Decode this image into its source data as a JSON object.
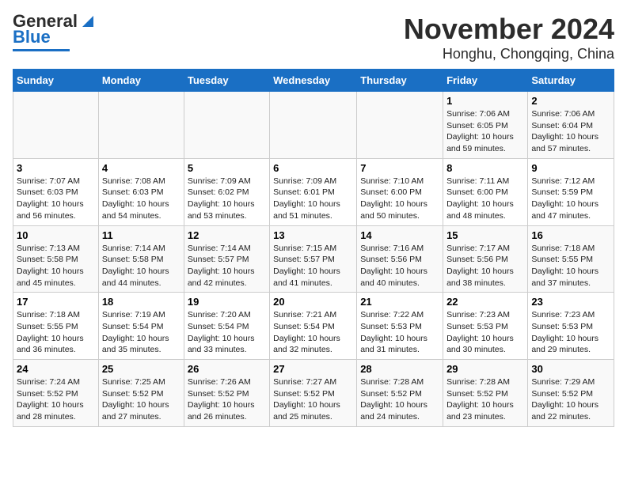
{
  "header": {
    "logo_line1": "General",
    "logo_line2": "Blue",
    "month": "November 2024",
    "location": "Honghu, Chongqing, China"
  },
  "columns": [
    "Sunday",
    "Monday",
    "Tuesday",
    "Wednesday",
    "Thursday",
    "Friday",
    "Saturday"
  ],
  "weeks": [
    [
      {
        "day": "",
        "info": ""
      },
      {
        "day": "",
        "info": ""
      },
      {
        "day": "",
        "info": ""
      },
      {
        "day": "",
        "info": ""
      },
      {
        "day": "",
        "info": ""
      },
      {
        "day": "1",
        "info": "Sunrise: 7:06 AM\nSunset: 6:05 PM\nDaylight: 10 hours and 59 minutes."
      },
      {
        "day": "2",
        "info": "Sunrise: 7:06 AM\nSunset: 6:04 PM\nDaylight: 10 hours and 57 minutes."
      }
    ],
    [
      {
        "day": "3",
        "info": "Sunrise: 7:07 AM\nSunset: 6:03 PM\nDaylight: 10 hours and 56 minutes."
      },
      {
        "day": "4",
        "info": "Sunrise: 7:08 AM\nSunset: 6:03 PM\nDaylight: 10 hours and 54 minutes."
      },
      {
        "day": "5",
        "info": "Sunrise: 7:09 AM\nSunset: 6:02 PM\nDaylight: 10 hours and 53 minutes."
      },
      {
        "day": "6",
        "info": "Sunrise: 7:09 AM\nSunset: 6:01 PM\nDaylight: 10 hours and 51 minutes."
      },
      {
        "day": "7",
        "info": "Sunrise: 7:10 AM\nSunset: 6:00 PM\nDaylight: 10 hours and 50 minutes."
      },
      {
        "day": "8",
        "info": "Sunrise: 7:11 AM\nSunset: 6:00 PM\nDaylight: 10 hours and 48 minutes."
      },
      {
        "day": "9",
        "info": "Sunrise: 7:12 AM\nSunset: 5:59 PM\nDaylight: 10 hours and 47 minutes."
      }
    ],
    [
      {
        "day": "10",
        "info": "Sunrise: 7:13 AM\nSunset: 5:58 PM\nDaylight: 10 hours and 45 minutes."
      },
      {
        "day": "11",
        "info": "Sunrise: 7:14 AM\nSunset: 5:58 PM\nDaylight: 10 hours and 44 minutes."
      },
      {
        "day": "12",
        "info": "Sunrise: 7:14 AM\nSunset: 5:57 PM\nDaylight: 10 hours and 42 minutes."
      },
      {
        "day": "13",
        "info": "Sunrise: 7:15 AM\nSunset: 5:57 PM\nDaylight: 10 hours and 41 minutes."
      },
      {
        "day": "14",
        "info": "Sunrise: 7:16 AM\nSunset: 5:56 PM\nDaylight: 10 hours and 40 minutes."
      },
      {
        "day": "15",
        "info": "Sunrise: 7:17 AM\nSunset: 5:56 PM\nDaylight: 10 hours and 38 minutes."
      },
      {
        "day": "16",
        "info": "Sunrise: 7:18 AM\nSunset: 5:55 PM\nDaylight: 10 hours and 37 minutes."
      }
    ],
    [
      {
        "day": "17",
        "info": "Sunrise: 7:18 AM\nSunset: 5:55 PM\nDaylight: 10 hours and 36 minutes."
      },
      {
        "day": "18",
        "info": "Sunrise: 7:19 AM\nSunset: 5:54 PM\nDaylight: 10 hours and 35 minutes."
      },
      {
        "day": "19",
        "info": "Sunrise: 7:20 AM\nSunset: 5:54 PM\nDaylight: 10 hours and 33 minutes."
      },
      {
        "day": "20",
        "info": "Sunrise: 7:21 AM\nSunset: 5:54 PM\nDaylight: 10 hours and 32 minutes."
      },
      {
        "day": "21",
        "info": "Sunrise: 7:22 AM\nSunset: 5:53 PM\nDaylight: 10 hours and 31 minutes."
      },
      {
        "day": "22",
        "info": "Sunrise: 7:23 AM\nSunset: 5:53 PM\nDaylight: 10 hours and 30 minutes."
      },
      {
        "day": "23",
        "info": "Sunrise: 7:23 AM\nSunset: 5:53 PM\nDaylight: 10 hours and 29 minutes."
      }
    ],
    [
      {
        "day": "24",
        "info": "Sunrise: 7:24 AM\nSunset: 5:52 PM\nDaylight: 10 hours and 28 minutes."
      },
      {
        "day": "25",
        "info": "Sunrise: 7:25 AM\nSunset: 5:52 PM\nDaylight: 10 hours and 27 minutes."
      },
      {
        "day": "26",
        "info": "Sunrise: 7:26 AM\nSunset: 5:52 PM\nDaylight: 10 hours and 26 minutes."
      },
      {
        "day": "27",
        "info": "Sunrise: 7:27 AM\nSunset: 5:52 PM\nDaylight: 10 hours and 25 minutes."
      },
      {
        "day": "28",
        "info": "Sunrise: 7:28 AM\nSunset: 5:52 PM\nDaylight: 10 hours and 24 minutes."
      },
      {
        "day": "29",
        "info": "Sunrise: 7:28 AM\nSunset: 5:52 PM\nDaylight: 10 hours and 23 minutes."
      },
      {
        "day": "30",
        "info": "Sunrise: 7:29 AM\nSunset: 5:52 PM\nDaylight: 10 hours and 22 minutes."
      }
    ]
  ]
}
